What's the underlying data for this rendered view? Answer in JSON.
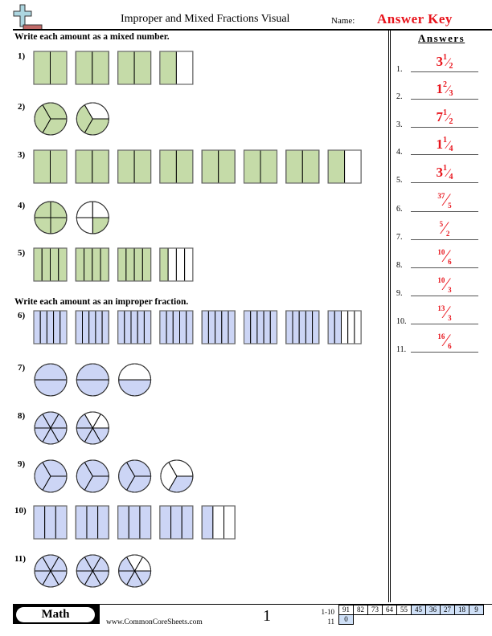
{
  "header": {
    "logo_icon": "plus-minus-logo-icon",
    "title": "Improper and Mixed Fractions Visual",
    "name_label": "Name:",
    "name_value": "Answer Key"
  },
  "colors": {
    "green_fill": "#c5dba8",
    "blue_fill": "#ccd5f5",
    "answer_red": "#e8141c",
    "score_blue": "#cfe0f7"
  },
  "sections": [
    {
      "instruction": "Write each amount as a mixed number."
    },
    {
      "instruction": "Write each amount as an improper fraction."
    }
  ],
  "problems": [
    {
      "label": "1)",
      "shape": "rect",
      "parts": 2,
      "filled": [
        2,
        2,
        2,
        1
      ],
      "color": "green"
    },
    {
      "label": "2)",
      "shape": "circle",
      "parts": 3,
      "filled": [
        3,
        2
      ],
      "color": "green"
    },
    {
      "label": "3)",
      "shape": "rect",
      "parts": 2,
      "filled": [
        2,
        2,
        2,
        2,
        2,
        2,
        2,
        1
      ],
      "color": "green"
    },
    {
      "label": "4)",
      "shape": "circle",
      "parts": 4,
      "filled": [
        4,
        1
      ],
      "color": "green"
    },
    {
      "label": "5)",
      "shape": "rect",
      "parts": 4,
      "filled": [
        4,
        4,
        4,
        1
      ],
      "color": "green"
    },
    {
      "label": "6)",
      "shape": "rect",
      "parts": 5,
      "filled": [
        5,
        5,
        5,
        5,
        5,
        5,
        5,
        2
      ],
      "color": "blue"
    },
    {
      "label": "7)",
      "shape": "circle",
      "parts": 2,
      "filled": [
        2,
        2,
        1
      ],
      "color": "blue"
    },
    {
      "label": "8)",
      "shape": "circle",
      "parts": 6,
      "filled": [
        6,
        4
      ],
      "color": "blue"
    },
    {
      "label": "9)",
      "shape": "circle",
      "parts": 3,
      "filled": [
        3,
        3,
        3,
        1
      ],
      "color": "blue"
    },
    {
      "label": "10)",
      "shape": "rect",
      "parts": 3,
      "filled": [
        3,
        3,
        3,
        3,
        1
      ],
      "color": "blue"
    },
    {
      "label": "11)",
      "shape": "circle",
      "parts": 6,
      "filled": [
        6,
        6,
        4
      ],
      "color": "blue"
    }
  ],
  "answers": {
    "heading": "Answers",
    "items": [
      {
        "num": "1.",
        "type": "mixed",
        "whole": "3",
        "numerator": "1",
        "denominator": "2"
      },
      {
        "num": "2.",
        "type": "mixed",
        "whole": "1",
        "numerator": "2",
        "denominator": "3"
      },
      {
        "num": "3.",
        "type": "mixed",
        "whole": "7",
        "numerator": "1",
        "denominator": "2"
      },
      {
        "num": "4.",
        "type": "mixed",
        "whole": "1",
        "numerator": "1",
        "denominator": "4"
      },
      {
        "num": "5.",
        "type": "mixed",
        "whole": "3",
        "numerator": "1",
        "denominator": "4"
      },
      {
        "num": "6.",
        "type": "improper",
        "whole": "",
        "numerator": "37",
        "denominator": "5"
      },
      {
        "num": "7.",
        "type": "improper",
        "whole": "",
        "numerator": "5",
        "denominator": "2"
      },
      {
        "num": "8.",
        "type": "improper",
        "whole": "",
        "numerator": "10",
        "denominator": "6"
      },
      {
        "num": "9.",
        "type": "improper",
        "whole": "",
        "numerator": "10",
        "denominator": "3"
      },
      {
        "num": "10.",
        "type": "improper",
        "whole": "",
        "numerator": "13",
        "denominator": "3"
      },
      {
        "num": "11.",
        "type": "improper",
        "whole": "",
        "numerator": "16",
        "denominator": "6"
      }
    ]
  },
  "footer": {
    "subject": "Math",
    "website": "www.CommonCoreSheets.com",
    "page": "1",
    "score_rows": [
      {
        "label": "1-10",
        "scores": [
          "91",
          "82",
          "73",
          "64",
          "55",
          "45",
          "36",
          "27",
          "18",
          "9"
        ]
      },
      {
        "label": "11",
        "scores": [
          "0"
        ]
      }
    ]
  }
}
